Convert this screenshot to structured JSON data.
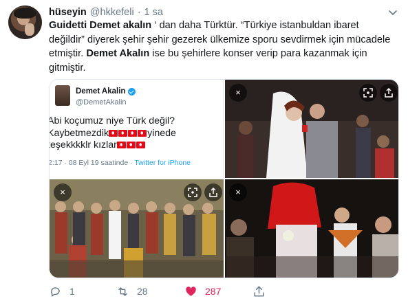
{
  "tweet": {
    "author_name": "hüseyin",
    "author_handle": "@hkkefeli",
    "separator": "·",
    "time": "1 sa",
    "text_part1": "Guidetti Demet akalın",
    "text_part2": " ‘ dan daha Türktür. “Türkiye istanbuldan ibaret değildir” diyerek şehir şehir gezerek ülkemize sporu sevdirmek için mücadele etmiştir. ",
    "text_part3": "Demet Akalın",
    "text_part4": " ise bu şehirlere konser verip para kazanmak için gitmiştir."
  },
  "embedded_tweet": {
    "name": "Demet Akalin",
    "handle": "@DemetAkalin",
    "line1": "Abi koçumuz niye Türk değil?",
    "line2_a": "Kaybetmezdik",
    "line2_b": "yinede",
    "line3_a": "teşekkkklr kızlar",
    "meta_time": "2:17 · 08 Eyl 19 saatinde · ",
    "meta_source": "Twitter for iPhone"
  },
  "overlay_icons": {
    "close": "×"
  },
  "actions": {
    "reply_count": "1",
    "retweet_count": "28",
    "like_count": "287"
  },
  "colors": {
    "accent": "#1da1f2",
    "like": "#e0245e",
    "muted": "#657786",
    "text": "#14171a"
  }
}
